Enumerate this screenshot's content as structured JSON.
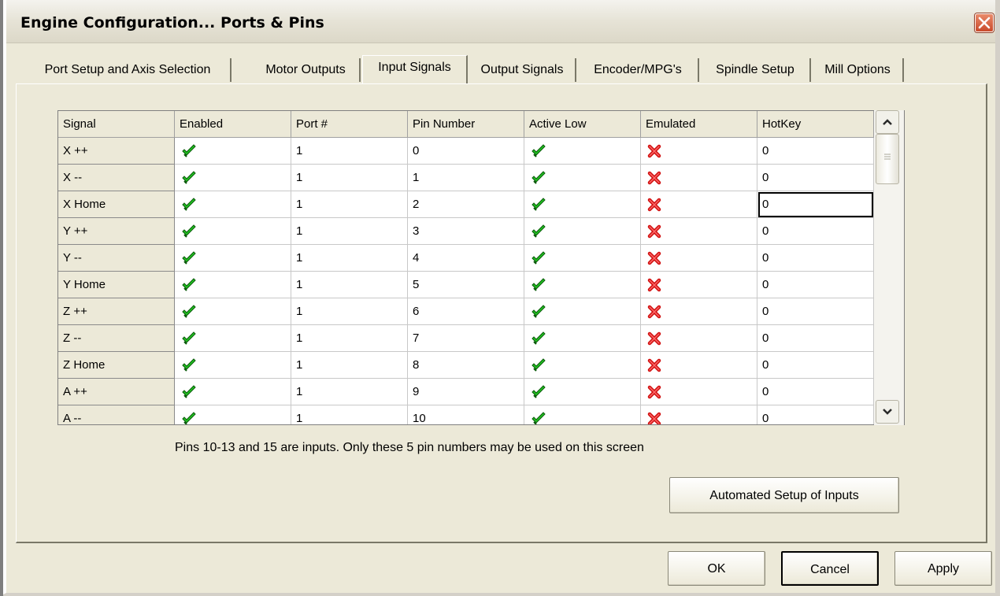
{
  "window": {
    "title": "Engine Configuration... Ports & Pins",
    "close_icon": "close-icon"
  },
  "tabs": [
    {
      "label": "Port Setup and Axis Selection",
      "active": false
    },
    {
      "label": "Motor Outputs",
      "active": false
    },
    {
      "label": "Input Signals",
      "active": true
    },
    {
      "label": "Output Signals",
      "active": false
    },
    {
      "label": "Encoder/MPG's",
      "active": false
    },
    {
      "label": "Spindle Setup",
      "active": false
    },
    {
      "label": "Mill Options",
      "active": false
    }
  ],
  "grid": {
    "columns": [
      "Signal",
      "Enabled",
      "Port #",
      "Pin Number",
      "Active Low",
      "Emulated",
      "HotKey"
    ],
    "rows": [
      {
        "signal": "X ++",
        "enabled": true,
        "port": "1",
        "pin": "0",
        "active_low": true,
        "emulated": false,
        "hotkey": "0"
      },
      {
        "signal": "X --",
        "enabled": true,
        "port": "1",
        "pin": "1",
        "active_low": true,
        "emulated": false,
        "hotkey": "0"
      },
      {
        "signal": "X Home",
        "enabled": true,
        "port": "1",
        "pin": "2",
        "active_low": true,
        "emulated": false,
        "hotkey": "0"
      },
      {
        "signal": "Y ++",
        "enabled": true,
        "port": "1",
        "pin": "3",
        "active_low": true,
        "emulated": false,
        "hotkey": "0"
      },
      {
        "signal": "Y --",
        "enabled": true,
        "port": "1",
        "pin": "4",
        "active_low": true,
        "emulated": false,
        "hotkey": "0"
      },
      {
        "signal": "Y Home",
        "enabled": true,
        "port": "1",
        "pin": "5",
        "active_low": true,
        "emulated": false,
        "hotkey": "0"
      },
      {
        "signal": "Z ++",
        "enabled": true,
        "port": "1",
        "pin": "6",
        "active_low": true,
        "emulated": false,
        "hotkey": "0"
      },
      {
        "signal": "Z --",
        "enabled": true,
        "port": "1",
        "pin": "7",
        "active_low": true,
        "emulated": false,
        "hotkey": "0"
      },
      {
        "signal": "Z Home",
        "enabled": true,
        "port": "1",
        "pin": "8",
        "active_low": true,
        "emulated": false,
        "hotkey": "0"
      },
      {
        "signal": "A ++",
        "enabled": true,
        "port": "1",
        "pin": "9",
        "active_low": true,
        "emulated": false,
        "hotkey": "0"
      },
      {
        "signal": "A --",
        "enabled": true,
        "port": "1",
        "pin": "10",
        "active_low": true,
        "emulated": false,
        "hotkey": "0"
      }
    ],
    "focused_cell": "X Home / HotKey",
    "check_icon": "green-check-icon",
    "x_icon": "red-x-icon"
  },
  "note": "Pins 10-13 and 15 are inputs. Only these 5 pin numbers may be used on this screen",
  "buttons": {
    "auto_setup": "Automated Setup of Inputs",
    "ok": "OK",
    "cancel": "Cancel",
    "apply": "Apply"
  },
  "colors": {
    "window_bg": "#ece9d8",
    "check_green": "#22c022",
    "x_red": "#d01010"
  }
}
